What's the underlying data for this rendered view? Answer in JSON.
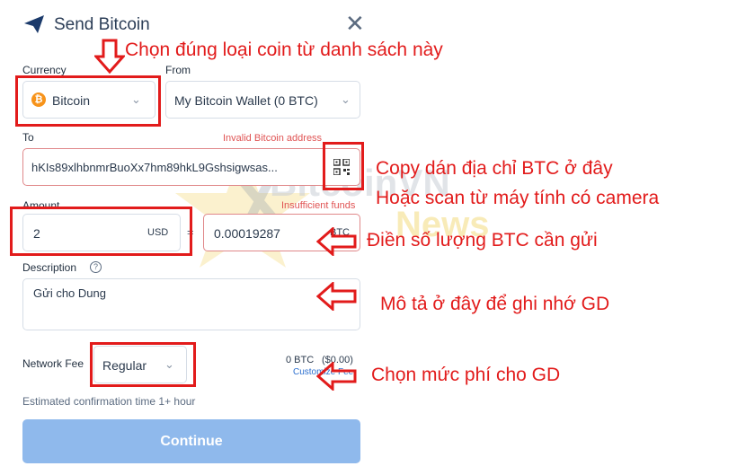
{
  "header": {
    "title": "Send Bitcoin",
    "close_glyph": "✕"
  },
  "currency": {
    "label": "Currency",
    "value": "Bitcoin",
    "coin_symbol": "₿"
  },
  "from": {
    "label": "From",
    "value": "My Bitcoin Wallet (0 BTC)"
  },
  "to": {
    "label": "To",
    "value": "hKIs89xlhbnmrBuoXx7hm89hkL9Gshsigwsas...",
    "error": "Invalid Bitcoin address"
  },
  "amount": {
    "label": "Amount",
    "fiat_value": "2",
    "fiat_unit": "USD",
    "equals": "=",
    "btc_value": "0.00019287",
    "btc_unit": "BTC",
    "error": "Insufficient funds"
  },
  "description": {
    "label": "Description",
    "help_glyph": "?",
    "value": "Gửi cho Dung"
  },
  "network_fee": {
    "label": "Network Fee",
    "value": "Regular",
    "amount": "0 BTC",
    "fiat": "($0.00)",
    "customize_link": "Customize Fee"
  },
  "estimate": "Estimated confirmation time 1+ hour",
  "continue_label": "Continue",
  "watermark": {
    "brand": "BitcoinVN",
    "sub": "News"
  },
  "annotations": {
    "choose_coin": "Chọn đúng loại coin từ danh sách này",
    "paste_address": "Copy dán địa chỉ BTC ở đây",
    "scan_address": "Hoặc scan từ máy tính có camera",
    "enter_amount": "Điền số lượng BTC cần gửi",
    "description_note": "Mô tả ở đây để ghi nhớ GD",
    "choose_fee": "Chọn mức phí cho GD"
  },
  "colors": {
    "annotation_red": "#e21b1b",
    "continue_blue": "#8fb9ec",
    "error_red": "#e05353",
    "bitcoin_orange": "#f7931a"
  }
}
